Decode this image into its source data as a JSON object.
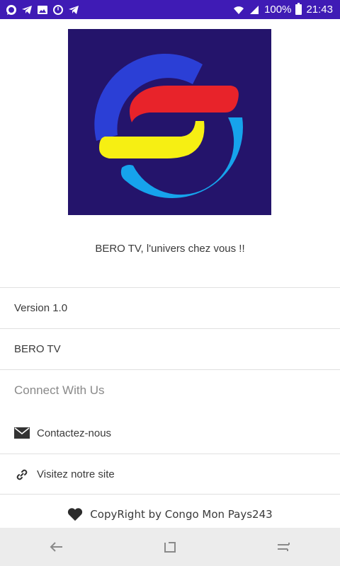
{
  "status_bar": {
    "battery_text": "100%",
    "battery_level": 1.0,
    "time": "21:43",
    "left_icons": [
      "whatsapp-icon",
      "telegram-icon",
      "image-icon",
      "clock-icon",
      "telegram-icon"
    ],
    "right_icons": [
      "wifi-icon",
      "signal-icon",
      "battery-icon"
    ],
    "background": "#3f1bb5"
  },
  "logo": {
    "background": "#24146b",
    "colors": [
      "#2b3fd6",
      "#e8232a",
      "#f6ef13",
      "#16a3ec"
    ]
  },
  "tagline": "BERO TV, l'univers chez vous !!",
  "rows": {
    "version": "Version 1.0",
    "app_name": "BERO TV"
  },
  "connect": {
    "title": "Connect With Us",
    "contact_label": "Contactez-nous",
    "contact_icon": "mail-icon",
    "site_label": "Visitez notre site",
    "site_icon": "link-icon"
  },
  "footer": {
    "text": "CopyRight by Congo Mon Pays243",
    "icon": "heart-icon"
  },
  "nav_bar": {
    "buttons": [
      "back-icon",
      "recents-icon",
      "home-icon"
    ]
  }
}
